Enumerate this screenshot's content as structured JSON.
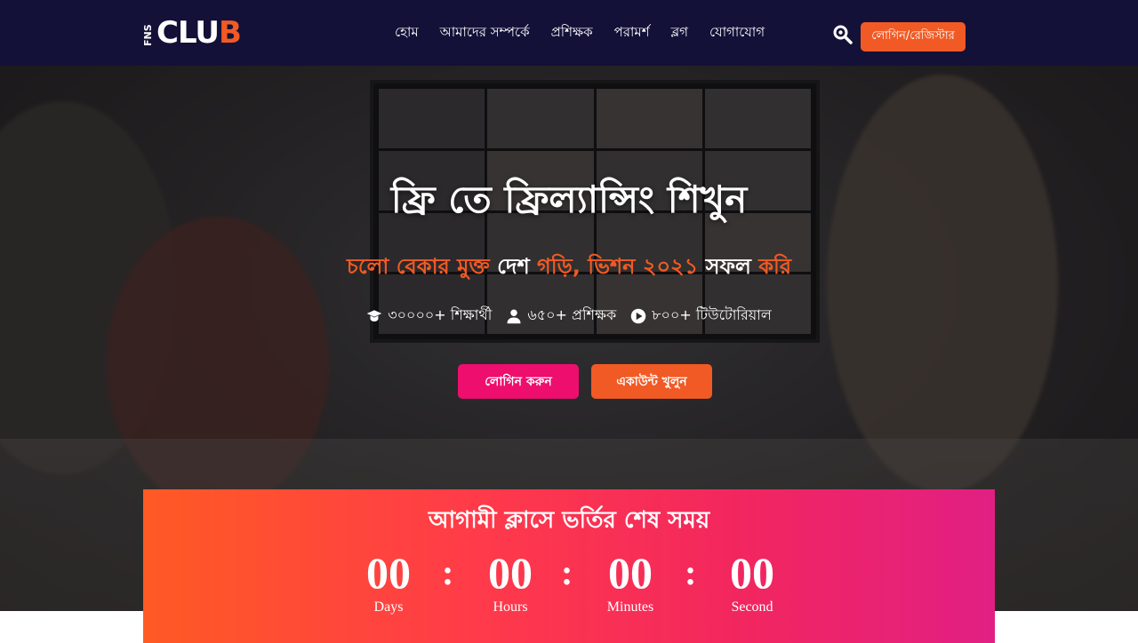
{
  "nav": {
    "logo_side": "FNS",
    "logo_main": "CLU",
    "logo_end": "B",
    "items": [
      "হোম",
      "আমাদের সম্পর্কে",
      "প্রশিক্ষক",
      "পরামর্শ",
      "ব্লগ",
      "যোগাযোগ"
    ],
    "register_button": "লোগিন/রেজিস্টার"
  },
  "hero": {
    "title": "ফ্রি তে ফ্রিল্যান্সিং শিখুন",
    "subtitle": {
      "part1": "চলো বেকার মুক্ত ",
      "part2": "দেশ ",
      "part3": "গড়ি, ভিশন ২০২১ ",
      "part4": "সফল ",
      "part5": "করি"
    },
    "stats": [
      {
        "icon": "graduate-icon",
        "text": "৩০০০০+ শিক্ষার্থী"
      },
      {
        "icon": "user-icon",
        "text": "৬৫০+ প্রশিক্ষক"
      },
      {
        "icon": "play-icon",
        "text": "৮০০+ টিউটোরিয়াল"
      }
    ],
    "login_button": "লোগিন করুন",
    "account_button": "একাউন্ট খুলুন"
  },
  "countdown": {
    "title": "আগামী ক্লাসে ভর্তির শেষ সময়",
    "units": [
      {
        "value": "00",
        "label": "Days"
      },
      {
        "value": "00",
        "label": "Hours"
      },
      {
        "value": "00",
        "label": "Minutes"
      },
      {
        "value": "00",
        "label": "Second"
      }
    ],
    "separator": ":"
  },
  "colors": {
    "nav_bg": "#131138",
    "accent_orange": "#f15a24",
    "accent_pink": "#ee0e6e"
  }
}
